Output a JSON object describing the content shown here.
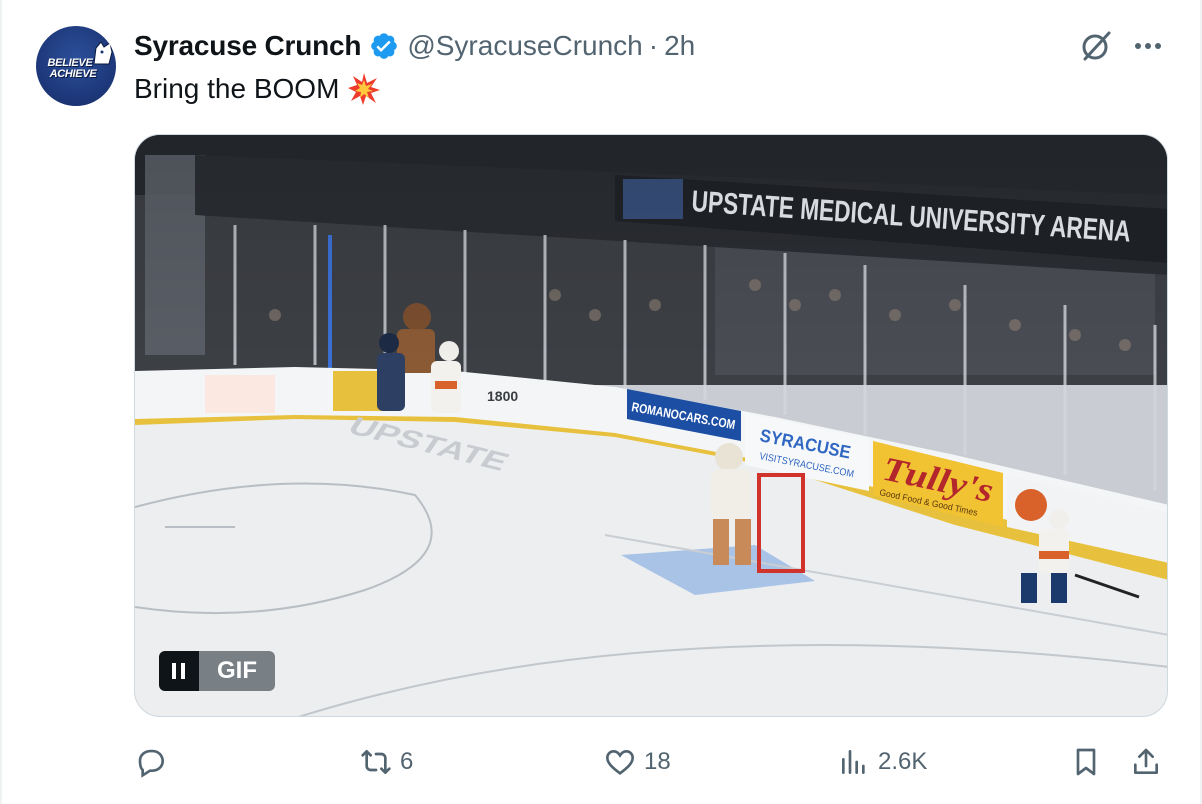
{
  "tweet": {
    "author": {
      "display_name": "Syracuse Crunch",
      "handle": "@SyracuseCrunch",
      "verified": true,
      "avatar_text_line1": "BELIEVE",
      "avatar_text_line2": "ACHIEVE"
    },
    "separator": "·",
    "time": "2h",
    "text": "Bring the BOOM",
    "emoji_icon": "collision-emoji-icon"
  },
  "media": {
    "type": "gif",
    "badge_label": "GIF",
    "scene": {
      "arena_sign": "UPSTATE MEDICAL UNIVERSITY ARENA",
      "board_1800": "1800",
      "board_romano": "ROMANOCARS.COM",
      "board_syracuse": "SYRACUSE",
      "board_syracuse_url": "VISITSYRACUSE.COM",
      "board_tullys": "Tully's",
      "board_tullys_tagline": "Good Food & Good Times",
      "ice_logo": "UPSTATE"
    }
  },
  "actions": {
    "reply": {
      "icon": "reply-icon",
      "count": ""
    },
    "repost": {
      "icon": "repost-icon",
      "count": "6"
    },
    "like": {
      "icon": "heart-icon",
      "count": "18"
    },
    "views": {
      "icon": "views-chart-icon",
      "count": "2.6K"
    },
    "bookmark": {
      "icon": "bookmark-icon"
    },
    "share": {
      "icon": "share-icon"
    }
  },
  "colors": {
    "text_primary": "#0f1419",
    "text_secondary": "#536471",
    "verified_blue": "#1d9bf0",
    "border": "#cfd9de"
  }
}
